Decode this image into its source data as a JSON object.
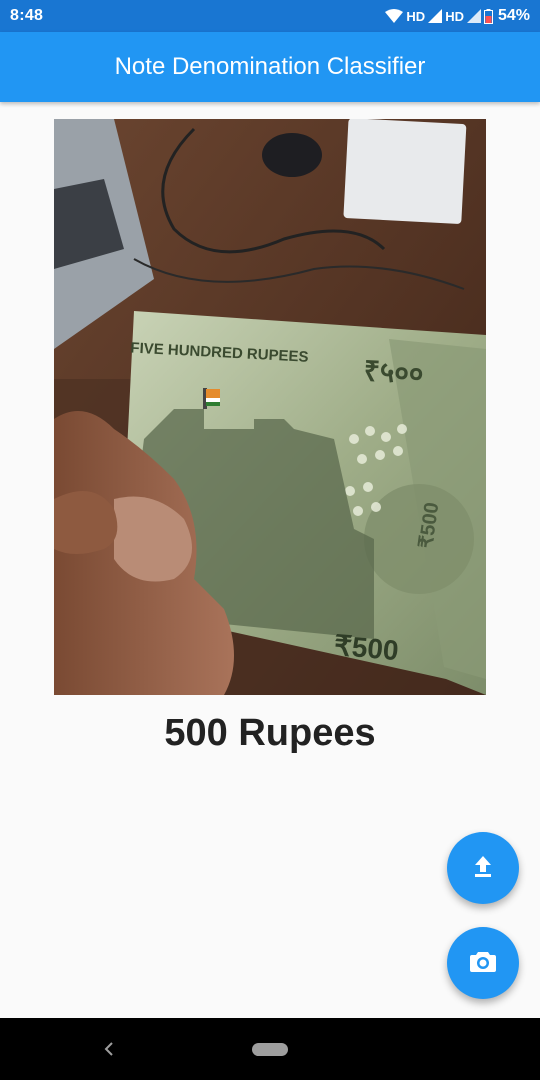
{
  "status_bar": {
    "time": "8:48",
    "network_1": "HD",
    "network_2": "HD",
    "battery": "54%"
  },
  "app_bar": {
    "title": "Note Denomination Classifier"
  },
  "photo": {
    "note_text_top": "FIVE HUNDRED RUPEES",
    "note_value_top": "₹५००",
    "note_value_bottom": "₹500",
    "note_value_vertical": "₹500"
  },
  "result": {
    "label": "500 Rupees"
  },
  "fabs": {
    "upload_icon": "upload-icon",
    "camera_icon": "camera-icon"
  },
  "colors": {
    "primary": "#2196f3",
    "primary_dark": "#1976d2"
  }
}
